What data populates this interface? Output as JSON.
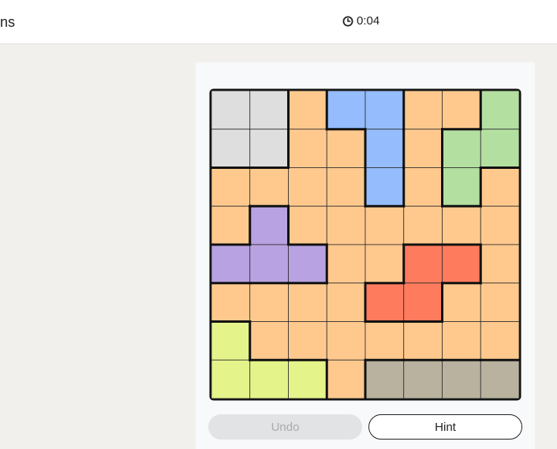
{
  "header": {
    "title": "ns",
    "timer": "0:04",
    "timer_icon": "clock-icon"
  },
  "board": {
    "rows": 8,
    "cols": 8,
    "grid": [
      "GGOBBOOL",
      "GGOOBOLL",
      "OOOOBOLO",
      "OPOOOOOO",
      "PPPOORRO",
      "OOOORROO",
      "YOOOOOOO",
      "YYYOTTTT"
    ],
    "colors": {
      "G": "#dedede",
      "O": "#ffc98e",
      "B": "#95bcfc",
      "L": "#b3dfa0",
      "P": "#b9a2e1",
      "R": "#ff7b5e",
      "Y": "#e4f48a",
      "T": "#b9b29f"
    },
    "region_names": {
      "G": "gray",
      "O": "orange",
      "B": "blue",
      "L": "green",
      "P": "purple",
      "R": "red",
      "Y": "yellow",
      "T": "tan"
    }
  },
  "controls": {
    "undo_label": "Undo",
    "hint_label": "Hint"
  }
}
